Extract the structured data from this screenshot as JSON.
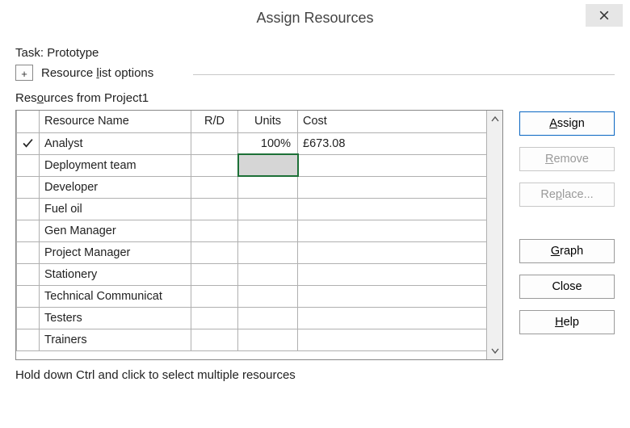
{
  "titlebar": {
    "title": "Assign Resources"
  },
  "task": {
    "label": "Task:",
    "name": "Prototype"
  },
  "options": {
    "text_pre": "Resource ",
    "text_u": "l",
    "text_post": "ist options"
  },
  "from": {
    "text_pre": "Res",
    "text_u": "o",
    "text_post": "urces from Project1"
  },
  "columns": {
    "name": "Resource Name",
    "rd": "R/D",
    "units": "Units",
    "cost": "Cost"
  },
  "rows": [
    {
      "checked": true,
      "name": "Analyst",
      "rd": "",
      "units": "100%",
      "cost": "£673.08"
    },
    {
      "checked": false,
      "name": "Deployment team",
      "rd": "",
      "units": "",
      "cost": "",
      "selected_units": true
    },
    {
      "checked": false,
      "name": "Developer",
      "rd": "",
      "units": "",
      "cost": ""
    },
    {
      "checked": false,
      "name": "Fuel oil",
      "rd": "",
      "units": "",
      "cost": ""
    },
    {
      "checked": false,
      "name": "Gen Manager",
      "rd": "",
      "units": "",
      "cost": ""
    },
    {
      "checked": false,
      "name": "Project Manager",
      "rd": "",
      "units": "",
      "cost": ""
    },
    {
      "checked": false,
      "name": "Stationery",
      "rd": "",
      "units": "",
      "cost": ""
    },
    {
      "checked": false,
      "name": "Technical Communicat",
      "rd": "",
      "units": "",
      "cost": ""
    },
    {
      "checked": false,
      "name": "Testers",
      "rd": "",
      "units": "",
      "cost": ""
    },
    {
      "checked": false,
      "name": "Trainers",
      "rd": "",
      "units": "",
      "cost": ""
    }
  ],
  "buttons": {
    "assign": {
      "u": "A",
      "rest": "ssign"
    },
    "remove": {
      "u": "R",
      "rest": "emove"
    },
    "replace": {
      "pre": "Re",
      "u": "p",
      "rest": "lace..."
    },
    "graph": {
      "u": "G",
      "rest": "raph"
    },
    "close": {
      "label": "Close"
    },
    "help": {
      "u": "H",
      "rest": "elp"
    }
  },
  "hint": "Hold down Ctrl and click to select multiple resources"
}
